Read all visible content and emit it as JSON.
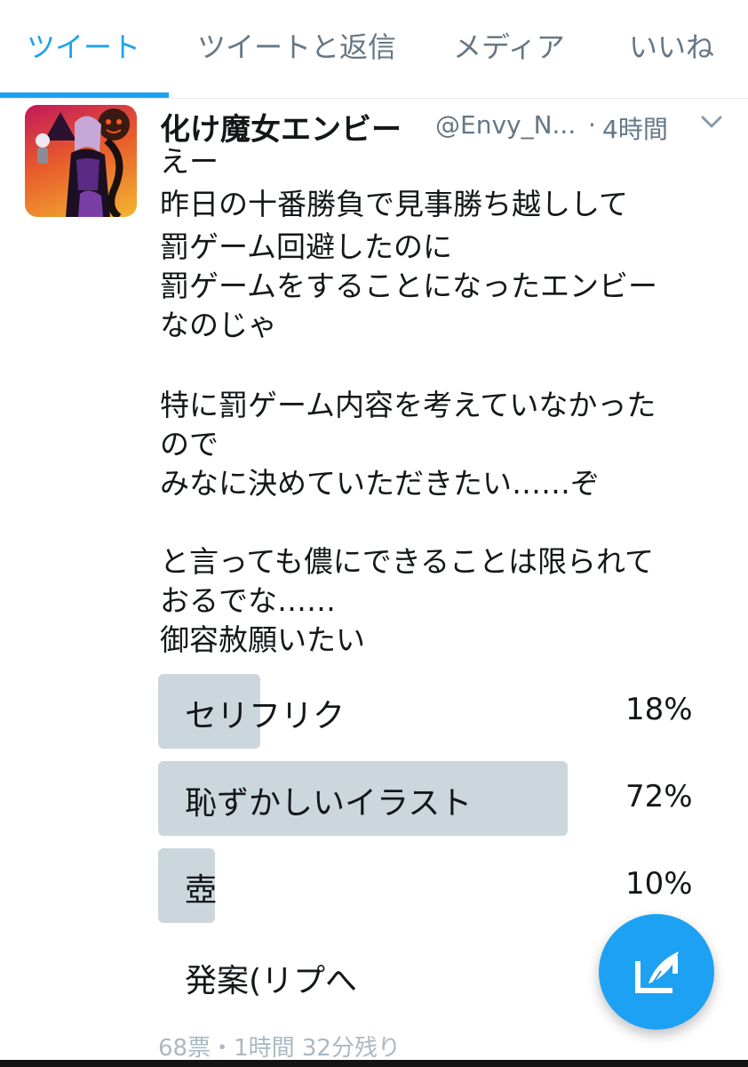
{
  "tabs": [
    {
      "label": "ツイート",
      "active": true
    },
    {
      "label": "ツイートと返信",
      "active": false
    },
    {
      "label": "メディア",
      "active": false
    },
    {
      "label": "いいね",
      "active": false
    }
  ],
  "tweet": {
    "display_name": "化け魔女エンビー",
    "handle": "@Envy_N...",
    "separator": "·",
    "time": "4時間",
    "lines": [
      "えー",
      "昨日の十番勝負で見事勝ち越しして",
      "罰ゲーム回避したのに",
      "罰ゲームをすることになったエンビー",
      "なのじゃ",
      "",
      "特に罰ゲーム内容を考えていなかった",
      "ので",
      "みなに決めていただきたい……ぞ",
      "",
      "と言っても儂にできることは限られて",
      "おるでな……",
      "御容赦願いたい"
    ]
  },
  "poll": {
    "options": [
      {
        "label": "セリフリク",
        "percent_text": "18%",
        "percent": 18
      },
      {
        "label": "恥ずかしいイラスト",
        "percent_text": "72%",
        "percent": 72
      },
      {
        "label": "壺",
        "percent_text": "10%",
        "percent": 10
      }
    ],
    "write_in": "発案(リプへ",
    "meta": "68票・1時間 32分残り"
  },
  "colors": {
    "accent": "#1da1f2",
    "poll_bar": "#ccd6dd",
    "muted": "#657786"
  },
  "icons": {
    "caret": "chevron-down-icon",
    "compose": "compose-tweet-icon"
  }
}
